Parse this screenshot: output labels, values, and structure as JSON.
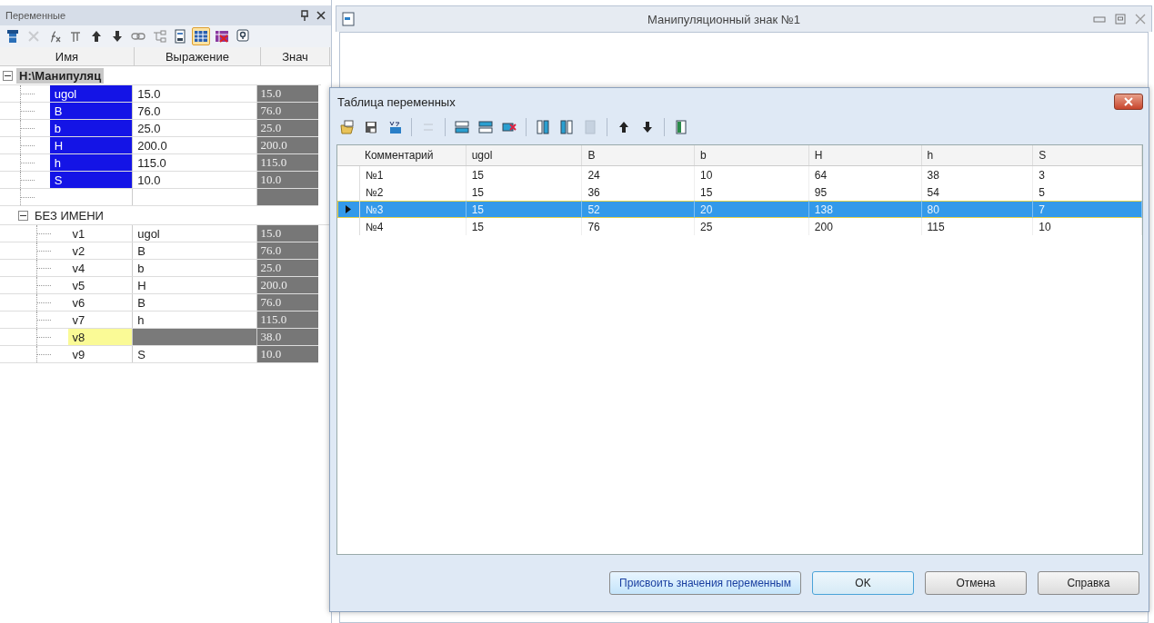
{
  "variables_panel": {
    "title": "Переменные",
    "toolbar": [
      {
        "pressed": false,
        "disabled": false
      },
      {
        "pressed": false,
        "disabled": true
      },
      {
        "pressed": false,
        "disabled": false
      },
      {
        "pressed": false,
        "disabled": false
      },
      {
        "pressed": false,
        "disabled": false
      },
      {
        "pressed": false,
        "disabled": false
      },
      {
        "pressed": false,
        "disabled": false
      },
      {
        "pressed": false,
        "disabled": false
      },
      {
        "pressed": false,
        "disabled": false
      },
      {
        "pressed": true,
        "disabled": false
      },
      {
        "pressed": false,
        "disabled": false
      },
      {
        "pressed": false,
        "disabled": false
      }
    ],
    "columns": [
      "Имя",
      "Выражение",
      "Знач"
    ],
    "groups": [
      {
        "label": "H:\\Манипуляц",
        "expanded": true,
        "selected": true,
        "rows": [
          {
            "kind": "variable",
            "name": "ugol",
            "expression": "15.0",
            "value": "15.0",
            "color": "#1414e6"
          },
          {
            "kind": "variable",
            "name": "B",
            "expression": "76.0",
            "value": "76.0",
            "color": "#1414e6"
          },
          {
            "kind": "variable",
            "name": "b",
            "expression": "25.0",
            "value": "25.0",
            "color": "#1414e6"
          },
          {
            "kind": "variable",
            "name": "H",
            "expression": "200.0",
            "value": "200.0",
            "color": "#1414e6"
          },
          {
            "kind": "variable",
            "name": "h",
            "expression": "115.0",
            "value": "115.0",
            "color": "#1414e6"
          },
          {
            "kind": "variable",
            "name": "S",
            "expression": "10.0",
            "value": "10.0",
            "color": "#1414e6"
          },
          {
            "kind": "blank"
          }
        ]
      },
      {
        "label": "БЕЗ ИМЕНИ",
        "expanded": true,
        "selected": false,
        "rows": [
          {
            "kind": "variable",
            "name": "v1",
            "expression": "ugol",
            "value": "15.0"
          },
          {
            "kind": "variable",
            "name": "v2",
            "expression": "B",
            "value": "76.0"
          },
          {
            "kind": "variable",
            "name": "v4",
            "expression": "b",
            "value": "25.0"
          },
          {
            "kind": "variable",
            "name": "v5",
            "expression": "H",
            "value": "200.0"
          },
          {
            "kind": "variable",
            "name": "v6",
            "expression": "B",
            "value": "76.0"
          },
          {
            "kind": "variable",
            "name": "v7",
            "expression": "h",
            "value": "115.0"
          },
          {
            "kind": "variable",
            "name": "v8",
            "value": "38.0",
            "color": "#fafa96"
          },
          {
            "kind": "variable",
            "name": "v9",
            "expression": "S",
            "value": "10.0"
          }
        ]
      }
    ]
  },
  "document_window": {
    "title": "Манипуляционный знак №1"
  },
  "dialog": {
    "title": "Таблица переменных",
    "toolbar": [
      {
        "disabled": false
      },
      {
        "disabled": false
      },
      {
        "disabled": false
      },
      {
        "disabled": true
      },
      {
        "disabled": false
      },
      {
        "disabled": false
      },
      {
        "disabled": false
      },
      {
        "disabled": false
      },
      {
        "disabled": false
      },
      {
        "disabled": true
      },
      {
        "disabled": false
      },
      {
        "disabled": false
      },
      {
        "disabled": false
      }
    ],
    "table": {
      "columns": [
        "Комментарий",
        "ugol",
        "B",
        "b",
        "H",
        "h",
        "S"
      ],
      "rows": [
        {
          "cells": [
            "№1",
            "15",
            "24",
            "10",
            "64",
            "38",
            "3"
          ],
          "selected": false
        },
        {
          "cells": [
            "№2",
            "15",
            "36",
            "15",
            "95",
            "54",
            "5"
          ],
          "selected": false
        },
        {
          "cells": [
            "№3",
            "15",
            "52",
            "20",
            "138",
            "80",
            "7"
          ],
          "selected": true
        },
        {
          "cells": [
            "№4",
            "15",
            "76",
            "25",
            "200",
            "115",
            "10"
          ],
          "selected": false
        }
      ]
    },
    "buttons": [
      {
        "label": "Присвоить значения переменным",
        "kind": "highlighted"
      },
      {
        "label": "OK",
        "kind": "default"
      },
      {
        "label": "Отмена",
        "kind": "normal"
      },
      {
        "label": "Справка",
        "kind": "normal"
      }
    ]
  }
}
